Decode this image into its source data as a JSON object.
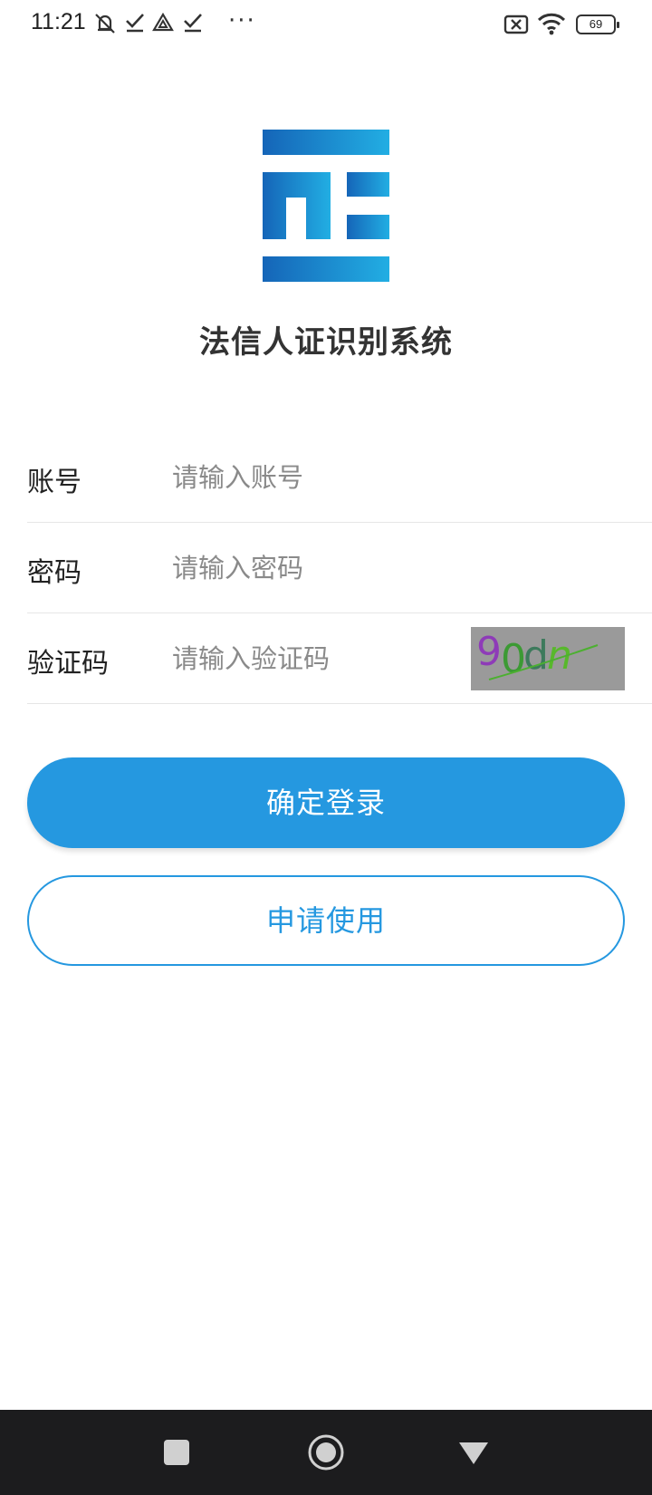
{
  "status_bar": {
    "time": "11:21",
    "battery": "69",
    "icons": [
      "mute-icon",
      "check-icon",
      "drive-icon",
      "check-icon",
      "more-icon",
      "close-box-icon",
      "wifi-icon",
      "battery-icon"
    ],
    "more": "···"
  },
  "app": {
    "logo_icon": "app-logo-icon",
    "title": "法信人证识别系统"
  },
  "form": {
    "account": {
      "label": "账号",
      "placeholder": "请输入账号",
      "value": ""
    },
    "password": {
      "label": "密码",
      "placeholder": "请输入密码",
      "value": ""
    },
    "captcha": {
      "label": "验证码",
      "placeholder": "请输入验证码",
      "value": "",
      "chars": [
        "9",
        "0",
        "d",
        "n"
      ]
    }
  },
  "buttons": {
    "login": "确定登录",
    "apply": "申请使用"
  },
  "nav_bar": {
    "icons": [
      "recent-apps-icon",
      "home-icon",
      "back-icon"
    ]
  },
  "colors": {
    "primary": "#2598e0",
    "captcha_bg": "#9a9a9a",
    "nav_bg": "#1c1c1e"
  }
}
